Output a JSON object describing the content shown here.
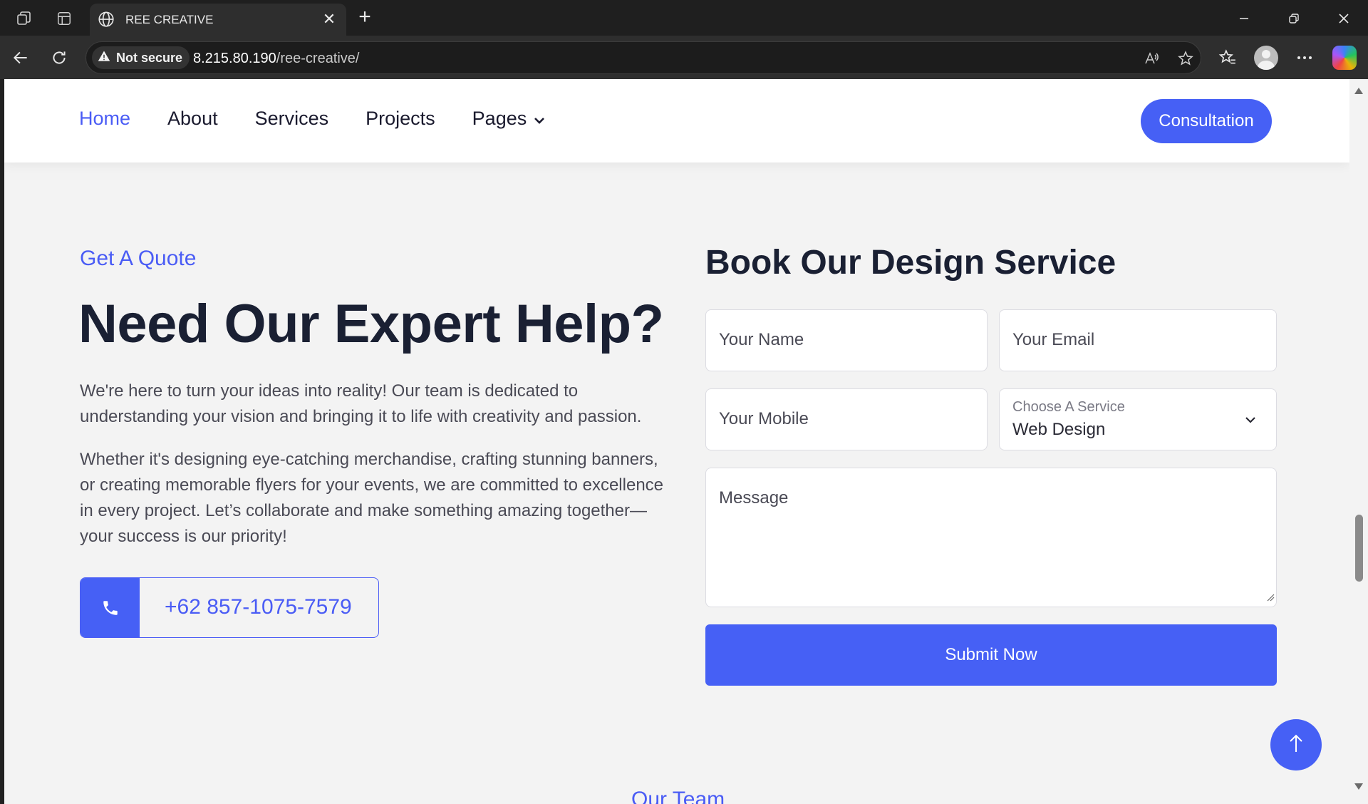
{
  "browser": {
    "tab_title": "REE CREATIVE",
    "security_label": "Not secure",
    "url_host": "8.215.80.190",
    "url_path": "/ree-creative/"
  },
  "nav": {
    "items": [
      {
        "label": "Home",
        "active": true
      },
      {
        "label": "About"
      },
      {
        "label": "Services"
      },
      {
        "label": "Projects"
      },
      {
        "label": "Pages",
        "has_dropdown": true
      }
    ],
    "cta_label": "Consultation"
  },
  "quote": {
    "eyebrow": "Get A Quote",
    "headline": "Need Our Expert Help?",
    "paragraphs": [
      "We're here to turn your ideas into reality! Our team is dedicated to understanding your vision and bringing it to life with creativity and passion.",
      "Whether it's designing eye-catching merchandise, crafting stunning banners, or creating memorable flyers for your events, we are committed to excellence in every project. Let’s collaborate and make something amazing together—your success is our priority!"
    ],
    "phone": "+62 857-1075-7579"
  },
  "form": {
    "title": "Book Our Design Service",
    "name_placeholder": "Your Name",
    "email_placeholder": "Your Email",
    "mobile_placeholder": "Your Mobile",
    "service_label": "Choose A Service",
    "service_value": "Web Design",
    "message_placeholder": "Message",
    "submit_label": "Submit Now"
  },
  "next_section_eyebrow": "Our Team",
  "colors": {
    "accent": "#4660f5",
    "heading": "#1a2033",
    "page_bg": "#f3f3f3"
  },
  "icons": [
    "workspaces-icon",
    "tab-actions-icon",
    "globe-icon",
    "close-icon",
    "plus-icon",
    "minimize-icon",
    "restore-icon",
    "back-icon",
    "refresh-icon",
    "warning-icon",
    "read-aloud-icon",
    "star-icon",
    "favorites-icon",
    "profile-icon",
    "more-icon",
    "copilot-icon",
    "chevron-down-icon",
    "phone-icon",
    "arrow-up-icon"
  ]
}
